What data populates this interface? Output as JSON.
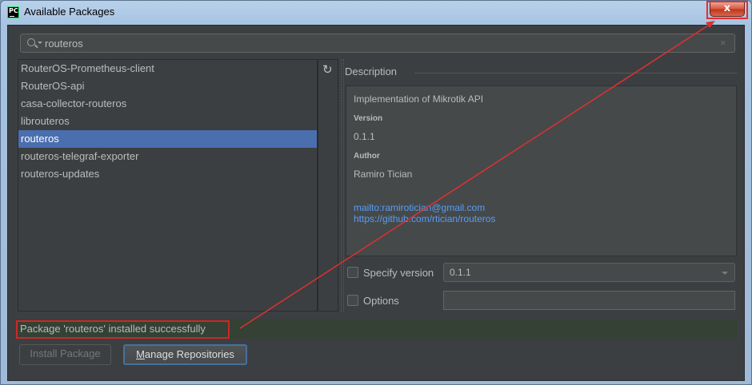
{
  "window": {
    "title": "Available Packages",
    "app_icon_text": "PC",
    "close_symbol": "x"
  },
  "search": {
    "value": "routeros",
    "clear_symbol": "×"
  },
  "packages": [
    {
      "label": "RouterOS-Prometheus-client",
      "selected": false
    },
    {
      "label": "RouterOS-api",
      "selected": false
    },
    {
      "label": "casa-collector-routeros",
      "selected": false
    },
    {
      "label": "librouteros",
      "selected": false
    },
    {
      "label": "routeros",
      "selected": true
    },
    {
      "label": "routeros-telegraf-exporter",
      "selected": false
    },
    {
      "label": "routeros-updates",
      "selected": false
    }
  ],
  "refresh_icon": "↻",
  "description": {
    "heading": "Description",
    "summary": "Implementation of Mikrotik API",
    "version_label": "Version",
    "version_value": "0.1.1",
    "author_label": "Author",
    "author_value": "Ramiro Tician",
    "link_email": "mailto:ramirotician@gmail.com",
    "link_repo": "https://github.com/rtician/routeros"
  },
  "specify_version": {
    "label": "Specify version",
    "checked": false,
    "value": "0.1.1"
  },
  "options": {
    "label": "Options",
    "checked": false,
    "value": ""
  },
  "status": {
    "message": "Package 'routeros' installed successfully"
  },
  "buttons": {
    "install_label": "Install Package",
    "manage_mnemonic": "M",
    "manage_rest": "anage Repositories"
  },
  "colors": {
    "selection": "#4b6eaf",
    "annotation": "#e03030",
    "link": "#589df6",
    "status_background": "#344134"
  }
}
